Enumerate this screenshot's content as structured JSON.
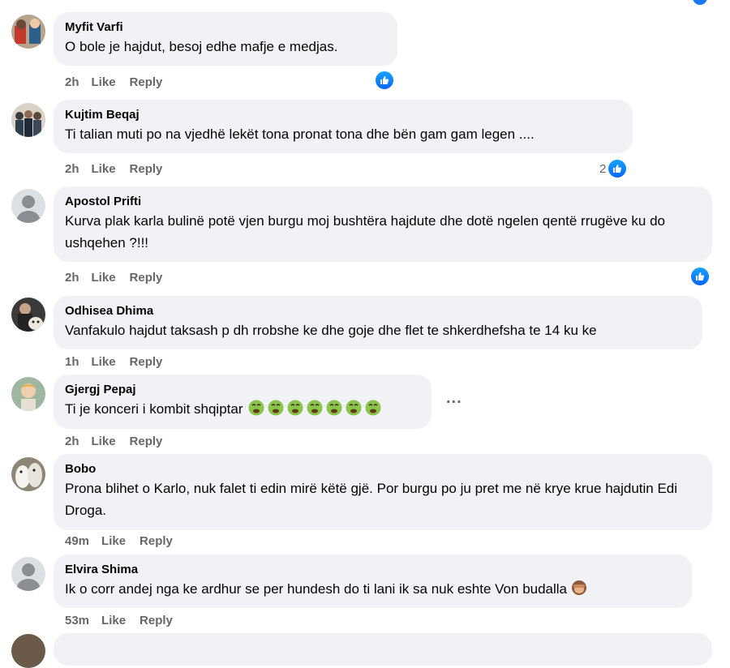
{
  "comments": [
    {
      "author": "Myfit Varfi",
      "text": "O bole je hajdut, besoj edhe mafje e medjas.",
      "time": "2h",
      "like": "Like",
      "reply": "Reply",
      "reactions": ""
    },
    {
      "author": "Kujtim Beqaj",
      "text": "Ti talian muti po na vjedhë lekët tona pronat tona dhe bën gam gam legen ....",
      "time": "2h",
      "like": "Like",
      "reply": "Reply",
      "reactions": "2"
    },
    {
      "author": "Apostol Prifti",
      "text": "Kurva plak karla bulinë potë vjen burgu moj bushtëra hajdute dhe dotë ngelen qentë rrugëve ku do ushqehen ?!!!",
      "time": "2h",
      "like": "Like",
      "reply": "Reply",
      "reactions": ""
    },
    {
      "author": "Odhisea Dhima",
      "text": "Vanfakulo hajdut taksash p dh rrobshe ke dhe goje dhe flet te shkerdhefsha te 14 ku ke",
      "time": "1h",
      "like": "Like",
      "reply": "Reply",
      "reactions": ""
    },
    {
      "author": "Gjergj Pepaj",
      "text": "Ti je konceri i kombit shqiptar",
      "time": "2h",
      "like": "Like",
      "reply": "Reply",
      "reactions": ""
    },
    {
      "author": "Bobo",
      "text": "Prona blihet o Karlo, nuk falet ti edin mirë këtë gjë. Por burgu po ju pret me në krye krue hajdutin Edi Droga.",
      "time": "49m",
      "like": "Like",
      "reply": "Reply",
      "reactions": ""
    },
    {
      "author": "Elvira Shima",
      "text": "Ik o corr andej nga ke ardhur se per hundesh do ti lani ik sa nuk eshte Von budalla",
      "time": "53m",
      "like": "Like",
      "reply": "Reply",
      "reactions": ""
    }
  ],
  "more_label": "...",
  "icons": {
    "reaction": "like-icon",
    "emoji_nauseated": "nauseated-face-icon",
    "emoji_monkey": "see-no-evil-monkey-icon",
    "default_avatar": "default-avatar-icon"
  },
  "colors": {
    "bubble": "#f0f2f5",
    "meta": "#65676b",
    "like_blue": "#0866ff"
  }
}
